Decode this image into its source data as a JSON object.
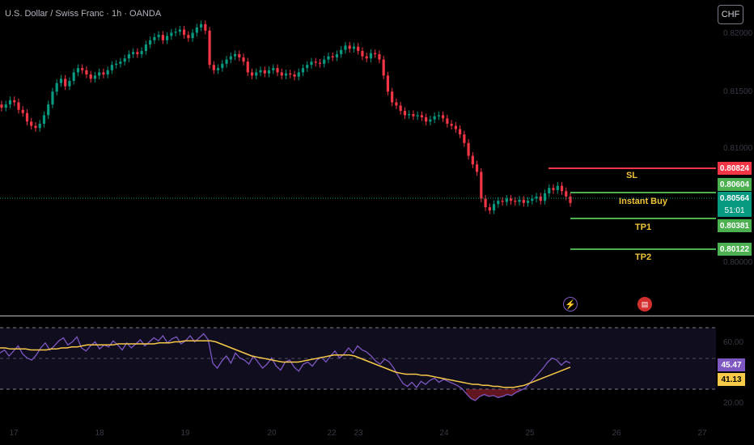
{
  "header": {
    "symbol_title": "U.S. Dollar / Swiss Franc · 1h · OANDA",
    "currency_button": "CHF"
  },
  "price_axis": {
    "ticks": [
      "0.82000",
      "0.81500",
      "0.81000",
      "0.80000"
    ]
  },
  "levels": {
    "sl": {
      "label": "SL",
      "price": "0.80824",
      "color": "#f23645"
    },
    "entry": {
      "label": "Instant Buy",
      "price": "0.80604",
      "color": "#4caf50"
    },
    "current": {
      "price": "0.80564",
      "countdown": "51:01",
      "color": "#089981"
    },
    "tp1": {
      "label": "TP1",
      "price": "0.80381",
      "color": "#4caf50"
    },
    "tp2": {
      "label": "TP2",
      "price": "0.80122",
      "color": "#4caf50"
    }
  },
  "events": {
    "bolt_icon": "lightning-icon",
    "flag_icon": "us-flag-icon"
  },
  "oscillator": {
    "ticks": [
      "60.00",
      "20.00"
    ],
    "rsi_value": "45.47",
    "ma_value": "41.13",
    "rsi_color": "#7e57c2",
    "ma_color": "#f7c948"
  },
  "x_axis": {
    "ticks": [
      "17",
      "18",
      "19",
      "20",
      "22",
      "23",
      "24",
      "25",
      "26",
      "27"
    ]
  },
  "colors": {
    "up": "#089981",
    "down": "#f23645",
    "background": "#000000"
  },
  "chart_data": {
    "type": "candlestick",
    "close_series": [
      0.8145,
      0.8148,
      0.8152,
      0.815,
      0.8143,
      0.814,
      0.8132,
      0.8128,
      0.8126,
      0.813,
      0.8138,
      0.8148,
      0.816,
      0.8168,
      0.8172,
      0.8165,
      0.817,
      0.8178,
      0.8182,
      0.818,
      0.8176,
      0.8172,
      0.8175,
      0.8178,
      0.8176,
      0.818,
      0.8185,
      0.8186,
      0.8188,
      0.8191,
      0.8195,
      0.8197,
      0.8195,
      0.8198,
      0.8204,
      0.8208,
      0.8211,
      0.8213,
      0.8208,
      0.8212,
      0.8215,
      0.8216,
      0.8218,
      0.8213,
      0.821,
      0.8215,
      0.822,
      0.8223,
      0.8217,
      0.8185,
      0.818,
      0.8182,
      0.8186,
      0.819,
      0.8193,
      0.8195,
      0.8192,
      0.8188,
      0.8178,
      0.8175,
      0.8178,
      0.818,
      0.8177,
      0.818,
      0.8182,
      0.8178,
      0.8175,
      0.8177,
      0.8176,
      0.8174,
      0.8178,
      0.8182,
      0.8185,
      0.8188,
      0.8187,
      0.8186,
      0.819,
      0.8193,
      0.8192,
      0.8195,
      0.8199,
      0.8203,
      0.82,
      0.8202,
      0.8198,
      0.8193,
      0.8191,
      0.8196,
      0.8195,
      0.819,
      0.8175,
      0.816,
      0.815,
      0.8147,
      0.8142,
      0.8138,
      0.8139,
      0.8137,
      0.8138,
      0.8136,
      0.8132,
      0.8134,
      0.8137,
      0.8138,
      0.8135,
      0.813,
      0.8128,
      0.8125,
      0.812,
      0.8112,
      0.81,
      0.8092,
      0.8085,
      0.806,
      0.8052,
      0.8049,
      0.8055,
      0.8058,
      0.8057,
      0.806,
      0.8058,
      0.8057,
      0.8059,
      0.8056,
      0.8058,
      0.806,
      0.8062,
      0.8058,
      0.8065,
      0.807,
      0.8068,
      0.8072,
      0.8067,
      0.8062,
      0.8056
    ],
    "rsi_series": [
      55,
      58,
      52,
      57,
      62,
      54,
      50,
      48,
      53,
      60,
      65,
      58,
      62,
      67,
      70,
      63,
      66,
      71,
      60,
      57,
      62,
      66,
      59,
      63,
      61,
      67,
      63,
      58,
      65,
      60,
      64,
      68,
      62,
      66,
      70,
      67,
      72,
      65,
      69,
      71,
      64,
      67,
      72,
      66,
      70,
      74,
      68,
      45,
      40,
      47,
      52,
      45,
      55,
      50,
      48,
      44,
      52,
      46,
      40,
      44,
      50,
      42,
      38,
      46,
      48,
      41,
      37,
      44,
      46,
      42,
      48,
      51,
      46,
      52,
      57,
      50,
      54,
      60,
      55,
      62,
      58,
      56,
      52,
      47,
      44,
      49,
      46,
      40,
      32,
      25,
      22,
      26,
      21,
      27,
      24,
      28,
      30,
      26,
      29,
      27,
      25,
      23,
      20,
      15,
      10,
      8,
      12,
      14,
      12,
      13,
      11,
      12,
      14,
      13,
      16,
      18,
      20,
      25,
      30,
      35,
      40,
      46,
      50,
      48,
      43,
      47,
      45
    ],
    "rsi_ma_series": [
      60,
      60,
      59,
      59,
      59,
      59,
      58,
      58,
      58,
      58,
      59,
      59,
      60,
      60,
      61,
      61,
      62,
      63,
      63,
      63,
      63,
      63,
      63,
      64,
      64,
      64,
      64,
      64,
      64,
      64,
      64,
      65,
      65,
      65,
      66,
      66,
      67,
      67,
      67,
      67,
      67,
      67,
      66,
      64,
      62,
      60,
      58,
      56,
      54,
      52,
      51,
      50,
      49,
      48,
      47,
      46,
      46,
      46,
      46,
      47,
      48,
      49,
      50,
      51,
      52,
      53,
      53,
      53,
      53,
      52,
      50,
      48,
      46,
      44,
      42,
      40,
      38,
      36,
      35,
      34,
      34,
      34,
      33,
      33,
      32,
      31,
      30,
      29,
      28,
      27,
      26,
      25,
      24,
      24,
      23,
      23,
      22,
      22,
      21,
      21,
      21,
      22,
      23,
      25,
      27,
      29,
      31,
      33,
      35,
      37,
      39,
      41
    ]
  }
}
